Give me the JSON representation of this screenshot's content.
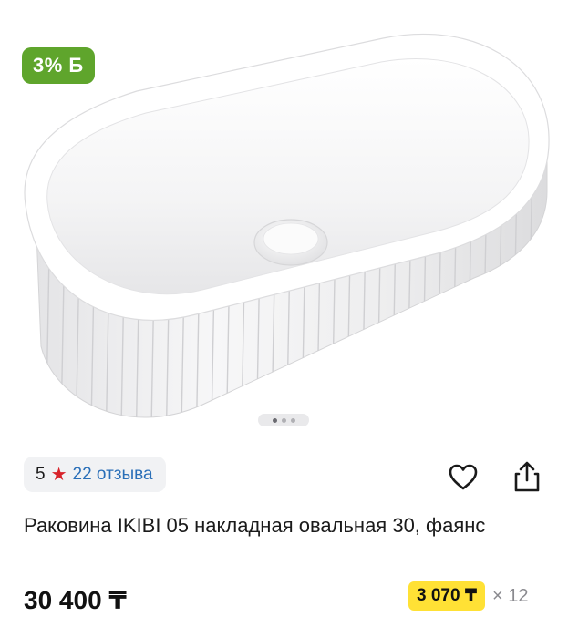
{
  "cashback_badge": {
    "label": "3% Б"
  },
  "carousel": {
    "dot_count": 3,
    "active_index": 0
  },
  "rating": {
    "score": "5",
    "reviews_label": "22 отзыва",
    "star_color": "#d8232a"
  },
  "actions": {
    "favorite_icon": "heart-outline-icon",
    "share_icon": "share-icon"
  },
  "product": {
    "title": "Раковина IKIBI 05 накладная овальная 30, фаянс",
    "price": "30 400 ₸"
  },
  "installment": {
    "amount": "3 070 ₸",
    "multiplier": "× 12",
    "highlight_color": "#ffe135"
  },
  "colors": {
    "cashback": "#5fa52c",
    "review_link": "#2a6fb8"
  }
}
